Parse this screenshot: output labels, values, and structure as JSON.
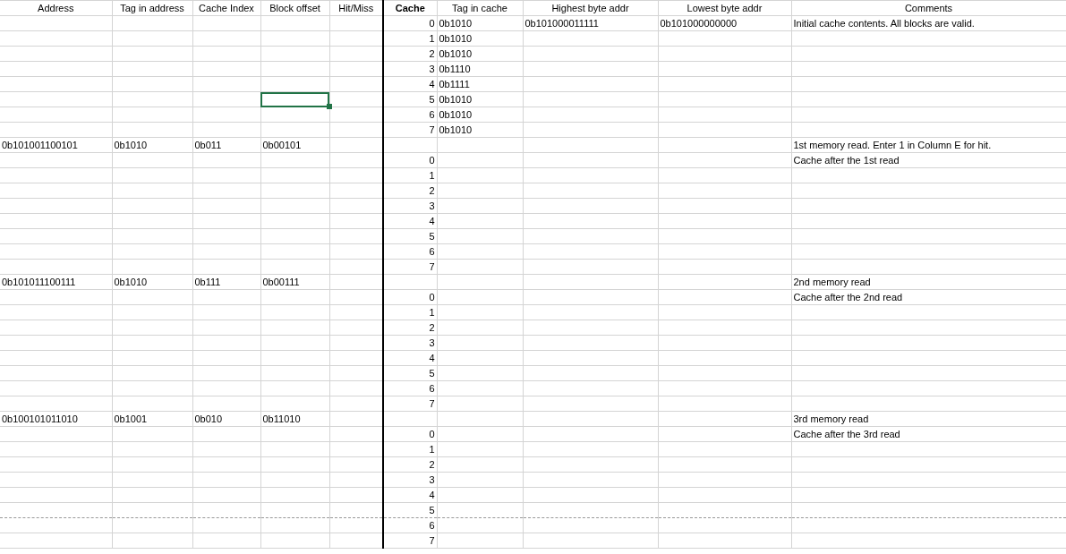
{
  "columns": [
    "Address",
    "Tag in address",
    "Cache Index",
    "Block offset",
    "Hit/Miss",
    "Cache",
    "Tag in cache",
    "Highest byte addr",
    "Lowest byte addr",
    "Comments"
  ],
  "rows": [
    {
      "cache": "0",
      "cache_tag": "0b1010",
      "highest": "0b101000011111",
      "lowest": "0b101000000000",
      "comment": "Initial cache contents. All blocks are valid."
    },
    {
      "cache": "1",
      "cache_tag": "0b1010"
    },
    {
      "cache": "2",
      "cache_tag": "0b1010"
    },
    {
      "cache": "3",
      "cache_tag": "0b1110"
    },
    {
      "cache": "4",
      "cache_tag": "0b1111"
    },
    {
      "cache": "5",
      "cache_tag": "0b1010",
      "offset_selected": true
    },
    {
      "cache": "6",
      "cache_tag": "0b1010"
    },
    {
      "cache": "7",
      "cache_tag": "0b1010"
    },
    {
      "address": "0b101001100101",
      "tag": "0b1010",
      "index": "0b011",
      "offset": "0b00101",
      "comment": "1st memory read. Enter 1 in Column E for hit."
    },
    {
      "cache": "0",
      "comment": "Cache after the 1st read"
    },
    {
      "cache": "1"
    },
    {
      "cache": "2"
    },
    {
      "cache": "3"
    },
    {
      "cache": "4"
    },
    {
      "cache": "5"
    },
    {
      "cache": "6"
    },
    {
      "cache": "7"
    },
    {
      "address": "0b101011100111",
      "tag": "0b1010",
      "index": "0b111",
      "offset": "0b00111",
      "comment": "2nd memory read"
    },
    {
      "cache": "0",
      "comment": "Cache after the 2nd read"
    },
    {
      "cache": "1"
    },
    {
      "cache": "2"
    },
    {
      "cache": "3"
    },
    {
      "cache": "4"
    },
    {
      "cache": "5"
    },
    {
      "cache": "6"
    },
    {
      "cache": "7"
    },
    {
      "address": "0b100101011010",
      "tag": "0b1001",
      "index": "0b010",
      "offset": "0b11010",
      "comment": "3rd memory read"
    },
    {
      "cache": "0",
      "comment": "Cache after the 3rd read"
    },
    {
      "cache": "1"
    },
    {
      "cache": "2"
    },
    {
      "cache": "3"
    },
    {
      "cache": "4"
    },
    {
      "cache": "5"
    },
    {
      "cache": "6"
    },
    {
      "cache": "7"
    }
  ]
}
